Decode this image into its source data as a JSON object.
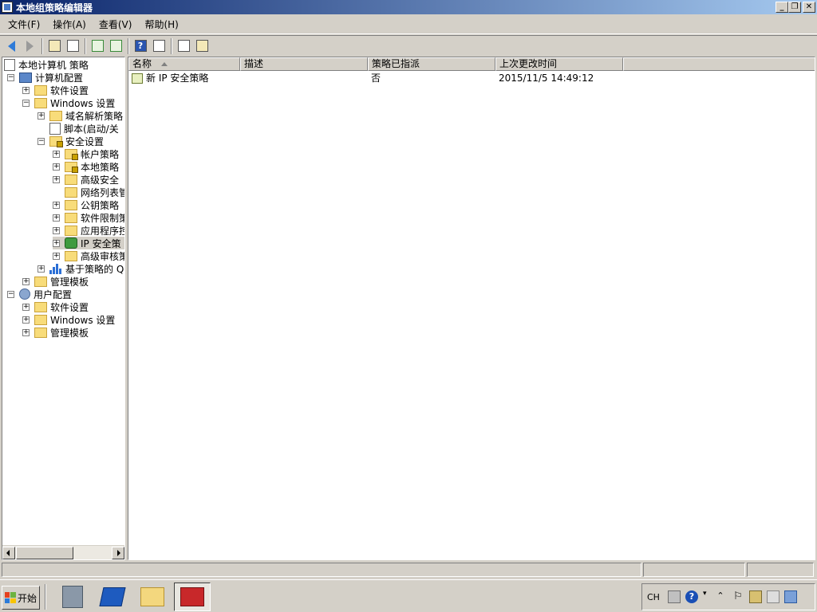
{
  "window": {
    "title": "本地组策略编辑器",
    "buttons": {
      "minimize": "_",
      "restore": "❐",
      "close": "✕"
    }
  },
  "menu": [
    "文件(F)",
    "操作(A)",
    "查看(V)",
    "帮助(H)"
  ],
  "toolbar": {
    "icons": [
      "back-icon",
      "forward-icon",
      "up-folder-icon",
      "show-hide-tree-icon",
      "refresh-icon",
      "export-list-icon",
      "help-icon",
      "action-pane-icon",
      "properties-icon",
      "export-icon"
    ],
    "help_glyph": "?"
  },
  "tree": {
    "root": "本地计算机 策略",
    "nodes": [
      {
        "label": "计算机配置",
        "expander": "−"
      },
      {
        "label": "软件设置",
        "expander": "+"
      },
      {
        "label": "Windows 设置",
        "expander": "−"
      },
      {
        "label": "域名解析策略",
        "expander": "+"
      },
      {
        "label": "脚本(启动/关",
        "expander": ""
      },
      {
        "label": "安全设置",
        "expander": "−"
      },
      {
        "label": "帐户策略",
        "expander": "+"
      },
      {
        "label": "本地策略",
        "expander": "+"
      },
      {
        "label": "高级安全",
        "expander": "+"
      },
      {
        "label": "网络列表管",
        "expander": ""
      },
      {
        "label": "公钥策略",
        "expander": "+"
      },
      {
        "label": "软件限制策",
        "expander": "+"
      },
      {
        "label": "应用程序控",
        "expander": "+"
      },
      {
        "label": "IP 安全策",
        "expander": "+"
      },
      {
        "label": "高级审核策",
        "expander": "+"
      },
      {
        "label": "基于策略的 Q",
        "expander": "+"
      },
      {
        "label": "管理模板",
        "expander": "+"
      },
      {
        "label": "用户配置",
        "expander": "−"
      },
      {
        "label": "软件设置",
        "expander": "+"
      },
      {
        "label": "Windows 设置",
        "expander": "+"
      },
      {
        "label": "管理模板",
        "expander": "+"
      }
    ]
  },
  "list": {
    "columns": [
      "名称",
      "描述",
      "策略已指派",
      "上次更改时间"
    ],
    "rows": [
      {
        "name": "新 IP 安全策略",
        "description": "",
        "assigned": "否",
        "modified": "2015/11/5 14:49:12"
      }
    ]
  },
  "taskbar": {
    "start_label": "开始",
    "apps": [
      "server-manager-icon",
      "powershell-icon",
      "explorer-icon",
      "group-policy-editor-icon"
    ],
    "tray": {
      "language": "CH"
    }
  },
  "colors": {
    "title_gradient_start": "#0a246a",
    "title_gradient_end": "#a6caf0",
    "face": "#d4d0c8"
  }
}
